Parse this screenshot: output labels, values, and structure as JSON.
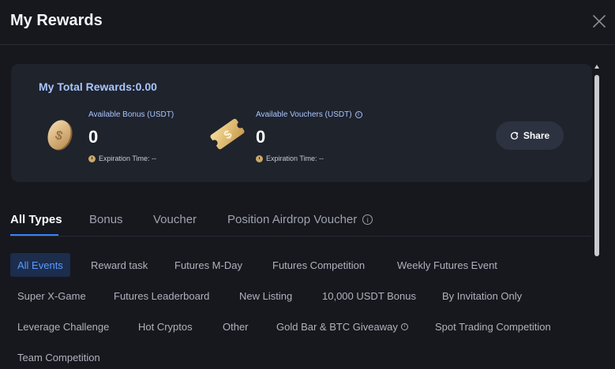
{
  "dialog": {
    "title": "My Rewards"
  },
  "summary": {
    "total_label": "My Total Rewards:0.00",
    "bonus": {
      "label": "Available Bonus (USDT)",
      "value": "0",
      "expiration": "Expiration Time: --",
      "icon": "coin-icon"
    },
    "vouchers": {
      "label": "Available Vouchers (USDT)",
      "value": "0",
      "expiration": "Expiration Time: --",
      "icon": "voucher-ticket-icon"
    },
    "share_label": "Share"
  },
  "tabs": [
    {
      "label": "All Types",
      "active": true
    },
    {
      "label": "Bonus",
      "active": false
    },
    {
      "label": "Voucher",
      "active": false
    },
    {
      "label": "Position Airdrop Voucher",
      "active": false
    }
  ],
  "filters": [
    {
      "label": "All Events",
      "active": true
    },
    {
      "label": "Reward task"
    },
    {
      "label": "Futures M-Day"
    },
    {
      "label": "Futures Competition"
    },
    {
      "label": "Weekly Futures Event"
    },
    {
      "label": "Super X-Game"
    },
    {
      "label": "Futures Leaderboard"
    },
    {
      "label": "New Listing"
    },
    {
      "label": "10,000 USDT Bonus"
    },
    {
      "label": "By Invitation Only"
    },
    {
      "label": "Leverage Challenge"
    },
    {
      "label": "Hot Cryptos"
    },
    {
      "label": "Other"
    },
    {
      "label": "Gold Bar & BTC Giveaway"
    },
    {
      "label": "Spot Trading Competition"
    },
    {
      "label": "Team Competition"
    }
  ],
  "colors": {
    "background": "#17181e",
    "card": "#1f232c",
    "accent_blue": "#3b82f6",
    "label_blue": "#a9c5ff",
    "gold": "#d9b679"
  }
}
